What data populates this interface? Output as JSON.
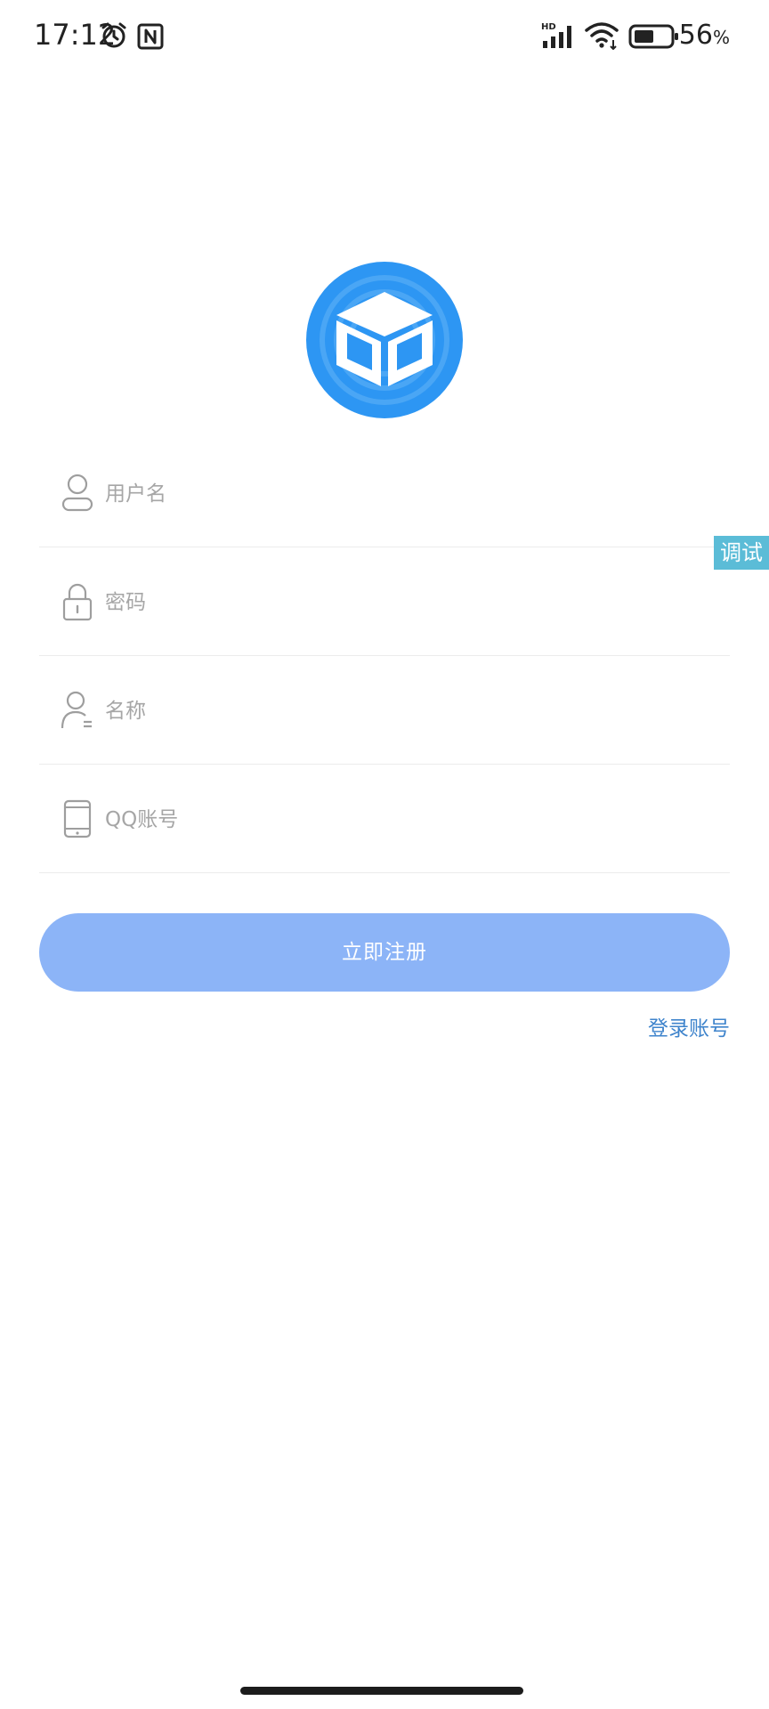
{
  "status_bar": {
    "time": "17:12",
    "battery_percent": "56",
    "battery_unit": "%",
    "battery_level": 0.56,
    "signal_label": "HD",
    "icons": [
      "alarm-icon",
      "nfc-icon",
      "signal-icon",
      "wifi-icon",
      "battery-icon"
    ]
  },
  "app": {
    "logo_icon": "cube-logo-icon",
    "accent_color": "#2d96f3"
  },
  "form": {
    "username_placeholder": "用户名",
    "password_placeholder": "密码",
    "nickname_placeholder": "名称",
    "qq_placeholder": "QQ账号"
  },
  "debug_tag": "调试",
  "register_button": "立即注册",
  "login_link": "登录账号",
  "colors": {
    "button": "#8cb4f7",
    "link": "#3f84cc",
    "debug": "#5bbcd7"
  }
}
